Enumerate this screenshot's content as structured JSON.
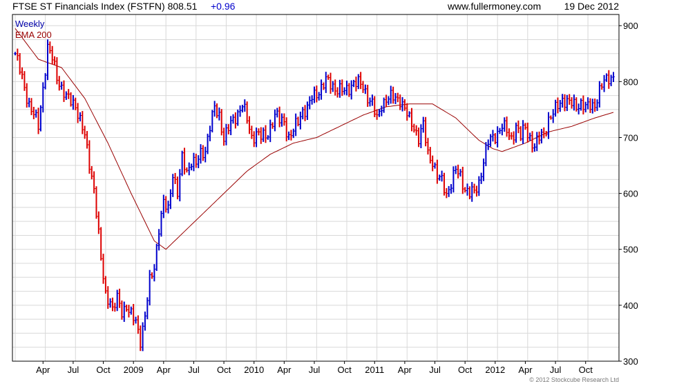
{
  "header": {
    "title": "FTSE ST Financials Index (FSTFN) 808.51",
    "change": "+0.96",
    "site": "www.fullermoney.com",
    "date": "19 Dec 2012"
  },
  "legend": {
    "period": "Weekly",
    "ema": "EMA 200"
  },
  "copyright": "© 2012 Stockcube Research Ltd",
  "colors": {
    "up": "#0000cc",
    "down": "#dd0000",
    "ema": "#990000",
    "grid": "#d8d8d8",
    "title_change": "#0000cc"
  },
  "chart_data": {
    "type": "line",
    "title": "FTSE ST Financials Index (FSTFN) 808.51 +0.96",
    "xlabel": "",
    "ylabel": "",
    "ylim": [
      300,
      920
    ],
    "yticks": [
      300,
      400,
      500,
      600,
      700,
      800,
      900
    ],
    "xticks": [
      "Apr",
      "Jul",
      "Oct",
      "2009",
      "Apr",
      "Jul",
      "Oct",
      "2010",
      "Apr",
      "Jul",
      "Oct",
      "2011",
      "Apr",
      "Jul",
      "Oct",
      "2012",
      "Apr",
      "Jul",
      "Oct"
    ],
    "xtick_weeks": [
      12,
      25,
      38,
      51,
      64,
      77,
      90,
      103,
      116,
      129,
      142,
      155,
      168,
      181,
      194,
      207,
      220,
      233,
      246
    ],
    "weeks": 259,
    "grid": true,
    "legend_position": "top-left",
    "price_series": {
      "name": "Weekly",
      "x_week": [
        0,
        6,
        10,
        12,
        14,
        16,
        18,
        22,
        26,
        30,
        34,
        37,
        39,
        41,
        42,
        44,
        46,
        48,
        50,
        52,
        54,
        56,
        58,
        60,
        62,
        64,
        66,
        68,
        70,
        72,
        74,
        76,
        78,
        80,
        82,
        84,
        86,
        88,
        90,
        94,
        98,
        102,
        104,
        106,
        108,
        110,
        112,
        114,
        116,
        118,
        120,
        122,
        124,
        126,
        128,
        130,
        134,
        138,
        142,
        146,
        150,
        154,
        156,
        158,
        160,
        162,
        164,
        166,
        168,
        170,
        172,
        174,
        176,
        178,
        180,
        182,
        184,
        186,
        188,
        190,
        192,
        194,
        196,
        198,
        200,
        202,
        204,
        206,
        208,
        210,
        212,
        214,
        216,
        218,
        220,
        222,
        224,
        226,
        228,
        230,
        232,
        234,
        236,
        238,
        240,
        242,
        244,
        246,
        248,
        250,
        252,
        254,
        256,
        258
      ],
      "y": [
        850,
        760,
        720,
        790,
        860,
        840,
        810,
        770,
        760,
        700,
        610,
        480,
        420,
        410,
        390,
        410,
        390,
        400,
        380,
        370,
        340,
        380,
        440,
        470,
        540,
        580,
        570,
        640,
        600,
        660,
        640,
        660,
        650,
        670,
        680,
        720,
        750,
        740,
        700,
        730,
        760,
        700,
        710,
        700,
        700,
        720,
        740,
        730,
        730,
        700,
        710,
        730,
        750,
        750,
        770,
        780,
        800,
        790,
        780,
        800,
        790,
        760,
        730,
        760,
        770,
        770,
        770,
        770,
        750,
        730,
        720,
        700,
        720,
        670,
        660,
        630,
        620,
        600,
        620,
        640,
        630,
        610,
        600,
        600,
        620,
        660,
        690,
        700,
        710,
        720,
        710,
        700,
        720,
        700,
        720,
        700,
        680,
        700,
        710,
        730,
        740,
        760,
        770,
        760,
        760,
        760,
        760,
        750,
        760,
        760,
        780,
        800,
        810,
        808.51
      ]
    },
    "ema_series": {
      "name": "EMA 200",
      "x_week": [
        0,
        10,
        20,
        30,
        40,
        50,
        60,
        65,
        70,
        80,
        90,
        100,
        110,
        120,
        130,
        140,
        150,
        160,
        170,
        180,
        190,
        200,
        206,
        210,
        220,
        230,
        240,
        250,
        258
      ],
      "y": [
        895,
        840,
        825,
        770,
        690,
        600,
        515,
        500,
        520,
        560,
        600,
        640,
        670,
        690,
        700,
        720,
        740,
        755,
        760,
        760,
        735,
        695,
        680,
        675,
        690,
        710,
        720,
        735,
        745
      ]
    }
  }
}
